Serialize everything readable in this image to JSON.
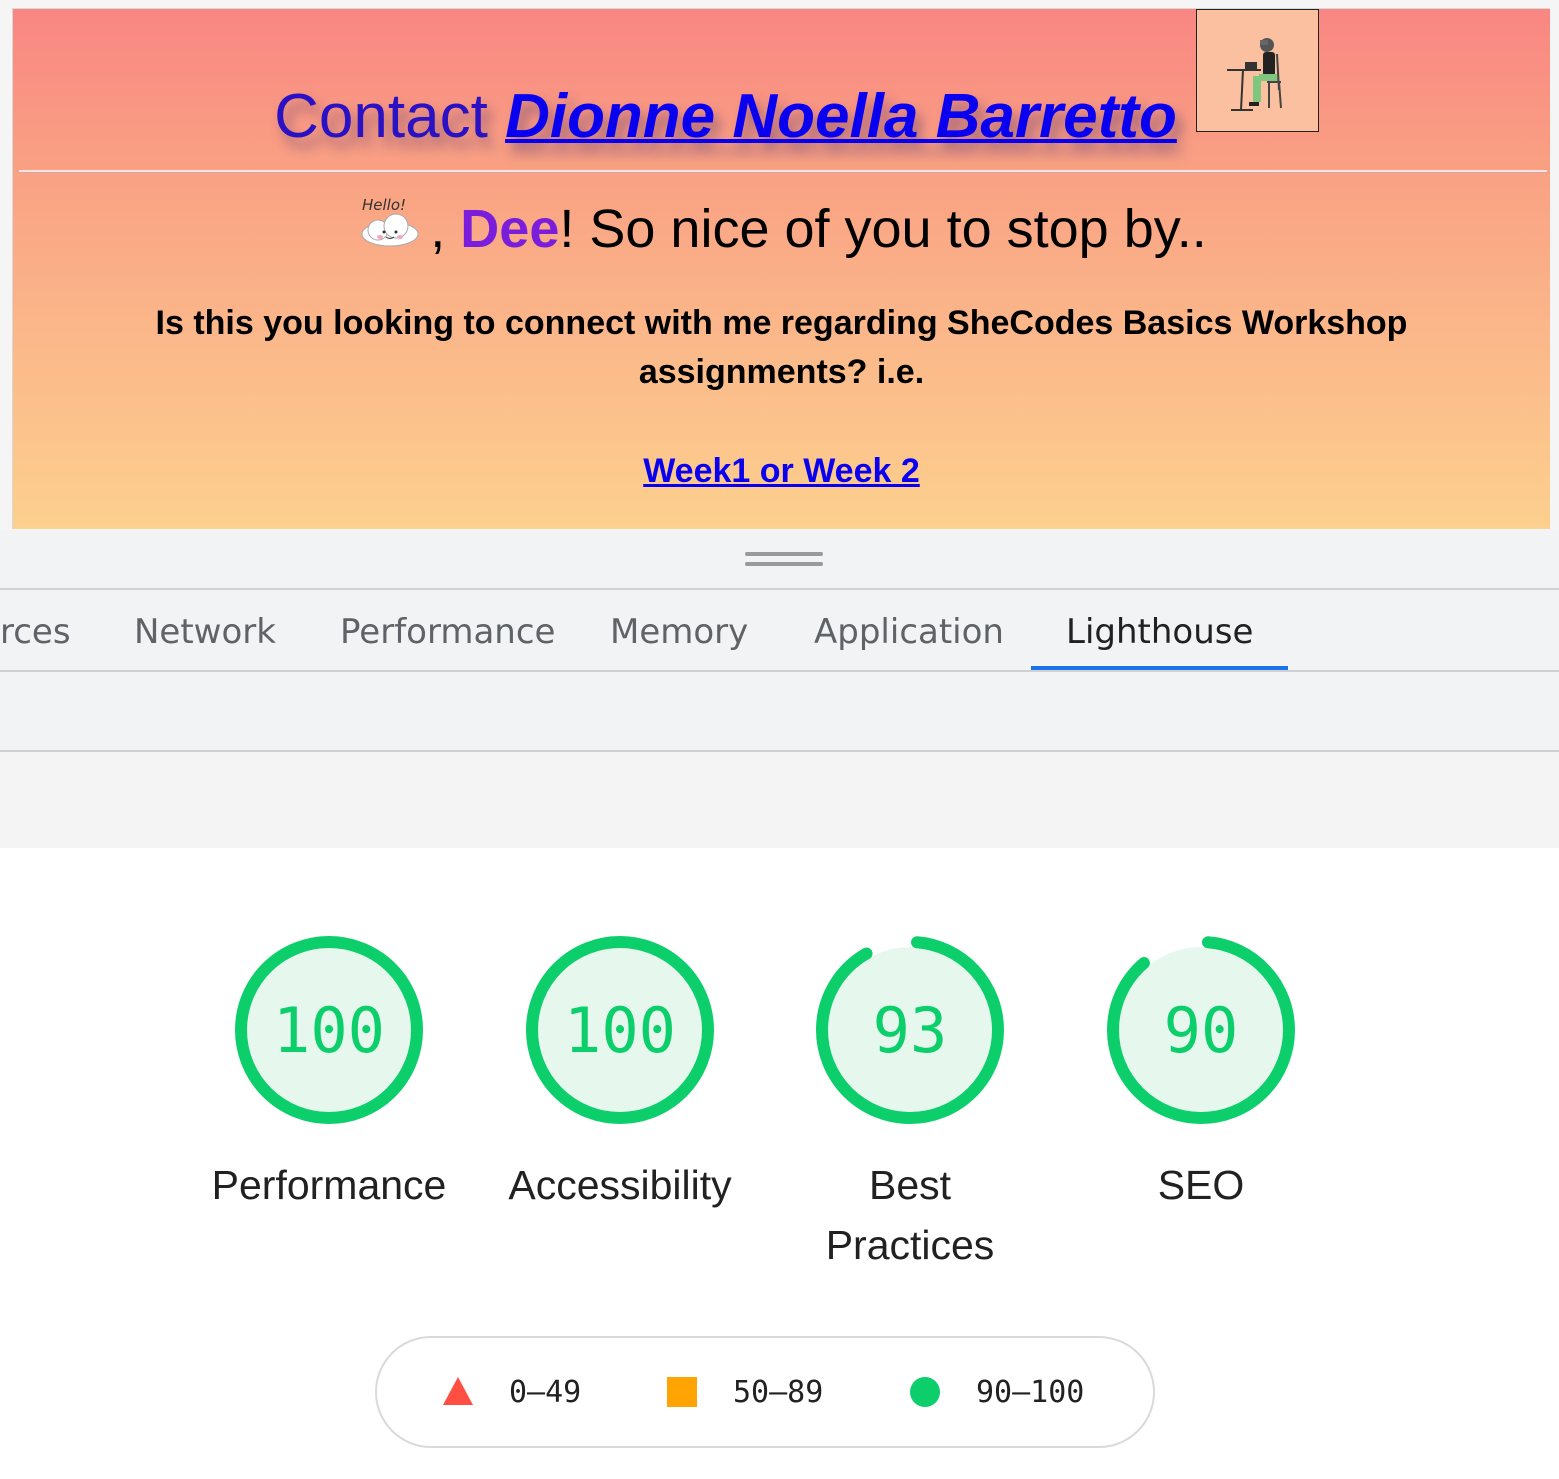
{
  "preview": {
    "heading_prefix": "Contact",
    "heading_link": "Dionne Noella Barretto",
    "greeting_sep": ",",
    "greeting_name": "Dee",
    "greeting_rest": "! So nice of you to stop by..",
    "question": "Is this you looking to connect with me regarding SheCodes Basics Workshop assignments? i.e.",
    "week_link": "Week1 or Week 2",
    "hello_img_text": "Hello!"
  },
  "devtools": {
    "tabs": [
      {
        "label": "rces"
      },
      {
        "label": "Network"
      },
      {
        "label": "Performance"
      },
      {
        "label": "Memory"
      },
      {
        "label": "Application"
      },
      {
        "label": "Lighthouse",
        "active": true
      }
    ]
  },
  "scores": [
    {
      "label": "Performance",
      "value": 100
    },
    {
      "label": "Accessibility",
      "value": 100
    },
    {
      "label": "Best Practices",
      "value": 93
    },
    {
      "label": "SEO",
      "value": 90
    }
  ],
  "legend": [
    {
      "range": "0–49",
      "shape": "triangle",
      "color": "#ff4e42"
    },
    {
      "range": "50–89",
      "shape": "square",
      "color": "#ffa400"
    },
    {
      "range": "90–100",
      "shape": "circle",
      "color": "#0cce6b"
    }
  ],
  "colors": {
    "pass": "#0cce6b",
    "pass_bg": "#e6f8ee",
    "accent_tab": "#1a73e8",
    "link": "#0a00f0",
    "name": "#7a1edb"
  }
}
